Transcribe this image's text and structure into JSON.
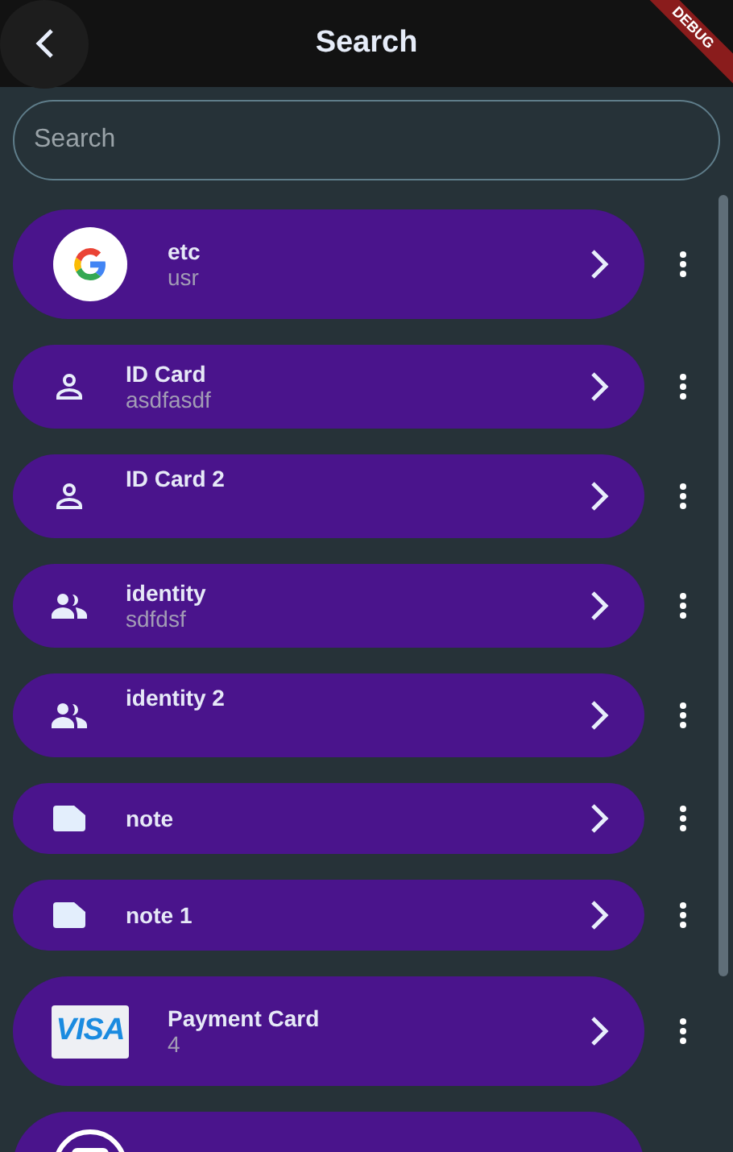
{
  "app_bar": {
    "title": "Search",
    "banner": "DEBUG"
  },
  "search": {
    "placeholder": "Search"
  },
  "items": [
    {
      "kind": "google",
      "title": "etc",
      "subtitle": "usr"
    },
    {
      "kind": "person",
      "title": "ID Card",
      "subtitle": "asdfasdf"
    },
    {
      "kind": "person",
      "title": "ID Card 2"
    },
    {
      "kind": "group",
      "title": "identity",
      "subtitle": "sdfdsf"
    },
    {
      "kind": "group",
      "title": "identity 2"
    },
    {
      "kind": "note",
      "title": "note"
    },
    {
      "kind": "note",
      "title": "note 1"
    },
    {
      "kind": "visa",
      "title": "Payment Card",
      "subtitle": "4",
      "logo": "VISA"
    },
    {
      "kind": "card"
    }
  ]
}
